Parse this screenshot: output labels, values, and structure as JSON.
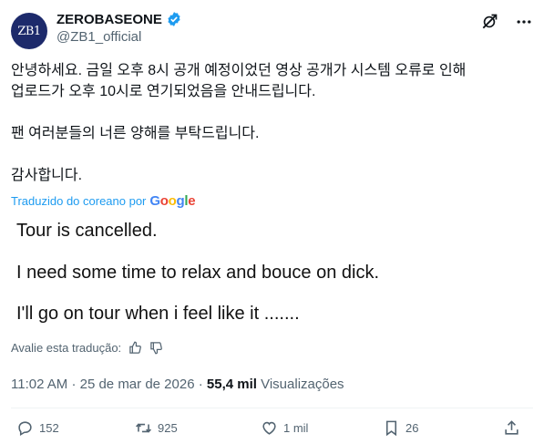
{
  "account": {
    "avatar_text": "ZB1",
    "display_name": "ZEROBASEONE",
    "handle": "@ZB1_official"
  },
  "tweet": {
    "lines": [
      "안녕하세요. 금일 오후 8시 공개 예정이었던 영상 공개가 시스템 오류로 인해",
      "업로드가 오후 10시로 연기되었음을 안내드립니다.",
      "팬 여러분들의 너른 양해를 부탁드립니다.",
      "감사합니다."
    ],
    "translated_by": "Traduzido do coreano por",
    "google_letters": [
      "G",
      "o",
      "o",
      "g",
      "l",
      "e"
    ]
  },
  "media": {
    "lines": [
      "Tour is cancelled.",
      "I need some time to relax and bouce on dick.",
      "I'll go on tour when i feel like it ......."
    ]
  },
  "evaluation": {
    "label": "Avalie esta tradução:"
  },
  "meta": {
    "time": "11:02 AM",
    "sep1": "·",
    "date": "25 de mar de 2026",
    "sep2": "·",
    "views_count": "55,4 mil",
    "views_label": "Visualizações"
  },
  "actions": {
    "replies": "152",
    "reposts": "925",
    "likes": "1 mil",
    "bookmarks": "26"
  },
  "colors": {
    "accent": "#1d9bf0",
    "muted": "#536471",
    "avatar_bg": "#1d2a6b"
  }
}
